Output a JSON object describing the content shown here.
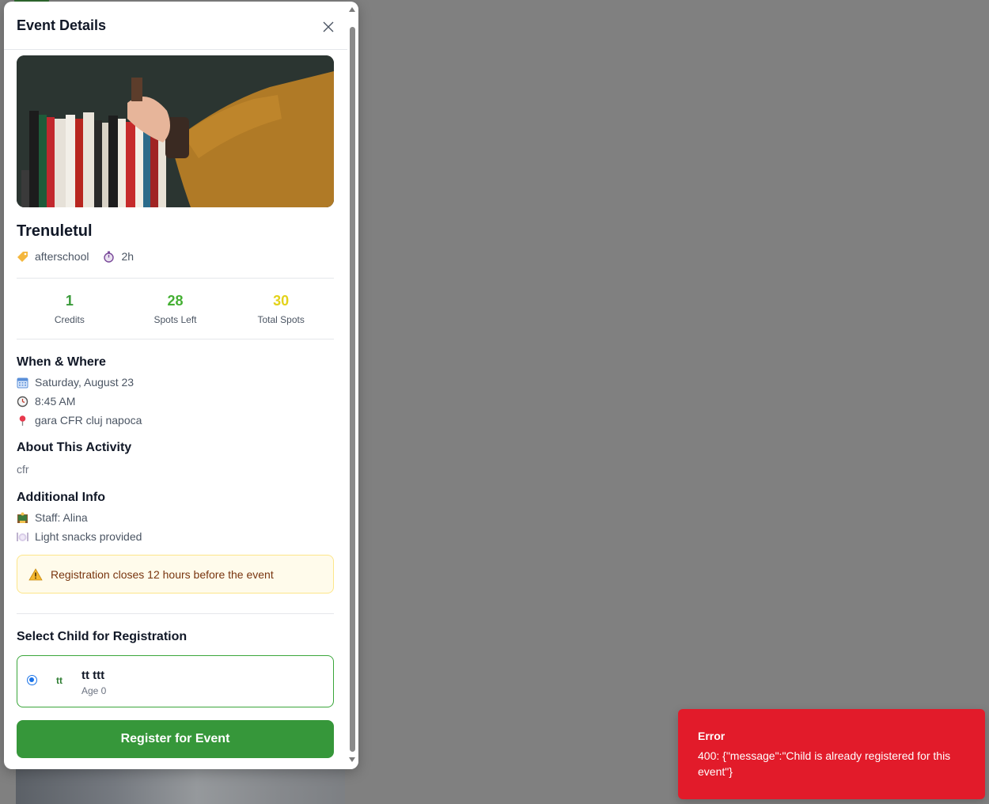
{
  "modal": {
    "title": "Event Details"
  },
  "event": {
    "title": "Trenuletul",
    "category": "afterschool",
    "duration": "2h"
  },
  "stats": [
    {
      "value": "1",
      "label": "Credits",
      "color": "#3a9a3a"
    },
    {
      "value": "28",
      "label": "Spots Left",
      "color": "#45b034"
    },
    {
      "value": "30",
      "label": "Total Spots",
      "color": "#e3d21a"
    }
  ],
  "when_where": {
    "heading": "When & Where",
    "date": "Saturday, August 23",
    "time": "8:45 AM",
    "location": "gara CFR cluj napoca"
  },
  "about": {
    "heading": "About This Activity",
    "text": "cfr"
  },
  "additional": {
    "heading": "Additional Info",
    "staff": "Staff: Alina",
    "snacks": "Light snacks provided"
  },
  "warning": {
    "text": "Registration closes 12 hours before the event"
  },
  "child_select": {
    "heading": "Select Child for Registration",
    "children": [
      {
        "initials": "tt",
        "name": "tt ttt",
        "age": "Age 0",
        "selected": true
      }
    ]
  },
  "register_label": "Register for Event",
  "toast": {
    "title": "Error",
    "message": "400: {\"message\":\"Child is already registered for this event\"}"
  },
  "icons": {
    "close": "close-icon",
    "tag": "tag-icon",
    "timer": "stopwatch-icon",
    "calendar": "calendar-icon",
    "clock": "clock-icon",
    "pin": "pin-icon",
    "staff": "staff-icon",
    "food": "plate-icon",
    "warning": "warning-icon"
  },
  "colors": {
    "primary": "#36973a",
    "error": "#e21b2a",
    "overlay": "#808080"
  }
}
